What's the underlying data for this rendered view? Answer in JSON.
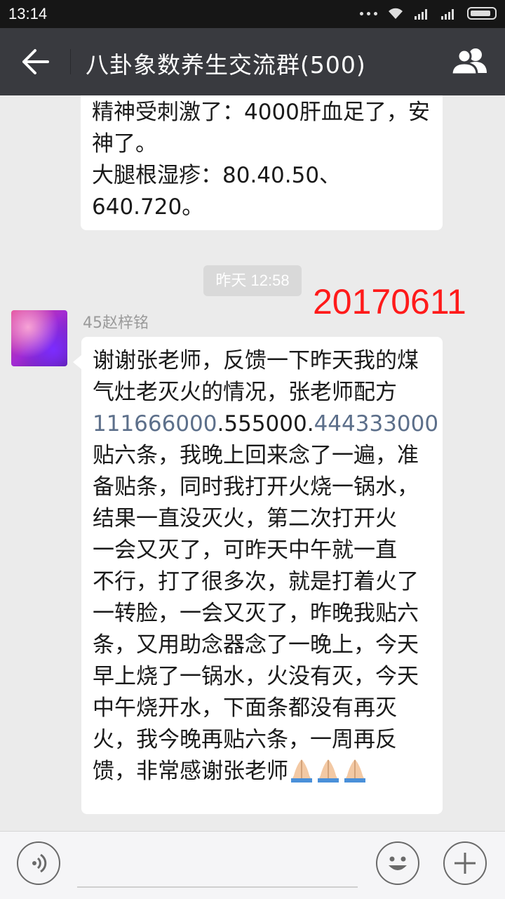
{
  "status": {
    "time": "13:14"
  },
  "header": {
    "title": "八卦象数养生交流群(500)"
  },
  "messages": {
    "prev": {
      "lines": [
        "精神受刺激了：4000肝血足了，安",
        "神了。",
        "大腿根湿疹：80.40.50、",
        "640.720。"
      ]
    },
    "timestamp": "昨天 12:58",
    "annotation": "20170611",
    "main": {
      "sender": "45赵梓铭",
      "line1": "谢谢张老师，反馈一下昨天我的煤",
      "line2": "气灶老灭火的情况，张老师配方",
      "code_a": "111666000",
      "code_b": ".555000.",
      "code_c": "444333000",
      "lines": [
        "贴六条，我晚上回来念了一遍，准",
        "备贴条，同时我打开火烧一锅水，",
        "结果一直没灭火，第二次打开火",
        "一会又灭了，可昨天中午就一直",
        "不行，打了很多次，就是打着火了",
        "一转脸，一会又灭了，昨晚我贴六",
        "条，又用助念器念了一晚上，今天",
        "早上烧了一锅水，火没有灭，今天",
        "中午烧开水，下面条都没有再灭",
        "火，我今晚再贴六条，一周再反"
      ],
      "last_line": "馈，非常感谢张老师"
    }
  },
  "icons": {
    "back": "arrow-left-icon",
    "group": "group-members-icon",
    "voice": "voice-input-icon",
    "emoji": "emoji-icon",
    "plus": "plus-icon",
    "pray": "folded-hands-emoji"
  }
}
